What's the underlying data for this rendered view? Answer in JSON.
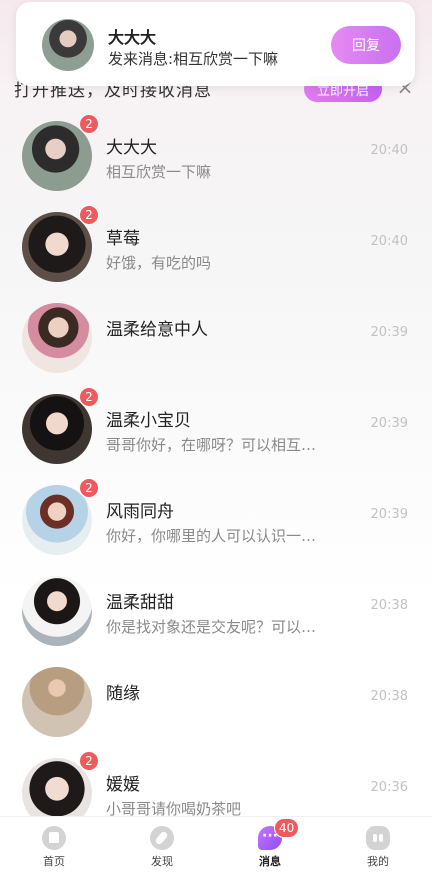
{
  "push_bar": {
    "text": "打开推送，及时接收消息",
    "button_label": "立即开启",
    "close_glyph": "×"
  },
  "banner": {
    "name": "大大大",
    "message": "发来消息:相互欣赏一下嘛",
    "reply_label": "回复"
  },
  "conversations": [
    {
      "name": "大大大",
      "preview": "相互欣赏一下嘛",
      "time": "20:40",
      "badge": "2",
      "avatar_icon": "avatar-photo"
    },
    {
      "name": "草莓",
      "preview": "好饿，有吃的吗",
      "time": "20:40",
      "badge": "2",
      "avatar_icon": "avatar-photo"
    },
    {
      "name": "温柔给意中人",
      "preview": "",
      "time": "20:39",
      "badge": "",
      "avatar_icon": "avatar-photo"
    },
    {
      "name": "温柔小宝贝",
      "preview": "哥哥你好，在哪呀？可以相互…",
      "time": "20:39",
      "badge": "2",
      "avatar_icon": "avatar-photo"
    },
    {
      "name": "风雨同舟",
      "preview": "你好，你哪里的人可以认识一…",
      "time": "20:39",
      "badge": "2",
      "avatar_icon": "avatar-photo"
    },
    {
      "name": "温柔甜甜",
      "preview": "你是找对象还是交友呢？可以…",
      "time": "20:38",
      "badge": "",
      "avatar_icon": "avatar-photo"
    },
    {
      "name": "随缘",
      "preview": "",
      "time": "20:38",
      "badge": "",
      "avatar_icon": "avatar-photo"
    },
    {
      "name": "媛媛",
      "preview": "小哥哥请你喝奶茶吧",
      "time": "20:36",
      "badge": "2",
      "avatar_icon": "avatar-photo"
    }
  ],
  "tabbar": {
    "tabs": [
      {
        "label": "首页",
        "icon": "home-icon"
      },
      {
        "label": "发现",
        "icon": "discover-icon"
      },
      {
        "label": "消息",
        "icon": "message-icon",
        "badge": "40",
        "active": true
      },
      {
        "label": "我的",
        "icon": "profile-icon"
      }
    ]
  },
  "colors": {
    "accent_gradient_start": "#e58af2",
    "accent_gradient_end": "#c970ef",
    "badge": "#ef5a5f",
    "time_text": "#c2c2c2",
    "preview_text": "#8a8a8a"
  }
}
